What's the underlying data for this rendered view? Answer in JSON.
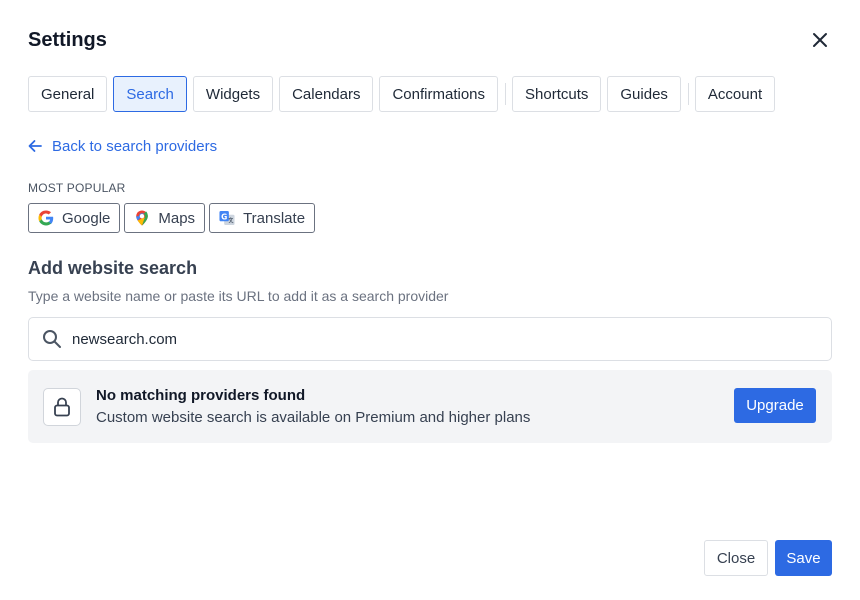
{
  "dialog": {
    "title": "Settings"
  },
  "tabs": [
    {
      "label": "General"
    },
    {
      "label": "Search",
      "active": true
    },
    {
      "label": "Widgets"
    },
    {
      "label": "Calendars"
    },
    {
      "label": "Confirmations"
    },
    {
      "label": "Shortcuts"
    },
    {
      "label": "Guides"
    },
    {
      "label": "Account"
    }
  ],
  "back_link": {
    "label": "Back to search providers",
    "icon": "arrow-left-icon"
  },
  "most_popular": {
    "label": "MOST POPULAR",
    "providers": [
      {
        "label": "Google",
        "icon": "google-icon"
      },
      {
        "label": "Maps",
        "icon": "maps-pin-icon"
      },
      {
        "label": "Translate",
        "icon": "translate-icon"
      }
    ]
  },
  "add_website": {
    "heading": "Add website search",
    "description": "Type a website name or paste its URL to add it as a search provider"
  },
  "search": {
    "value": "newsearch.com",
    "icon": "search-icon"
  },
  "notice": {
    "icon": "lock-icon",
    "title": "No matching providers found",
    "subtitle": "Custom website search is available on Premium and higher plans",
    "button_label": "Upgrade"
  },
  "footer": {
    "close_label": "Close",
    "save_label": "Save"
  },
  "colors": {
    "accent": "#2d6ae3",
    "accent_bg": "#e8f1fd",
    "notice_bg": "#f3f4f6"
  }
}
